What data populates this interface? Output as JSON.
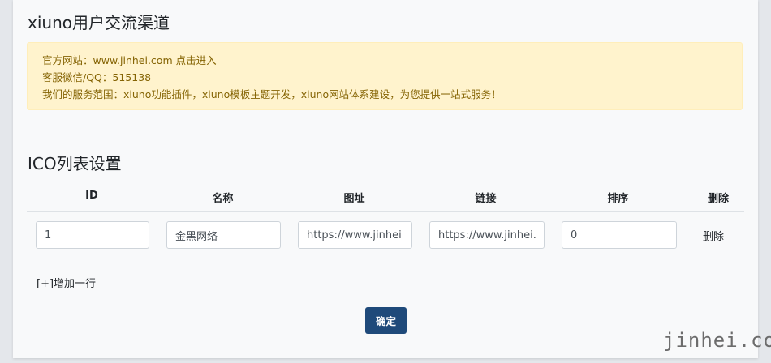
{
  "section1": {
    "title": "xiuno用户交流渠道",
    "alert_lines": [
      "官方网站：www.jinhei.com 点击进入",
      "客服微信/QQ：515138",
      "我们的服务范围：xiuno功能插件，xiuno模板主题开发，xiuno网站体系建设，为您提供一站式服务！"
    ]
  },
  "section2": {
    "title": "ICO列表设置",
    "columns": [
      "ID",
      "名称",
      "图址",
      "链接",
      "排序",
      "删除"
    ],
    "rows": [
      {
        "id": "1",
        "name": "金黑网络",
        "image_url": "https://www.jinhei.com",
        "link": "https://www.jinhei.com",
        "sort": "0",
        "delete_label": "删除"
      }
    ],
    "add_row_label": "[+]增加一行",
    "confirm_label": "确定"
  },
  "watermark": "jinhei.com"
}
